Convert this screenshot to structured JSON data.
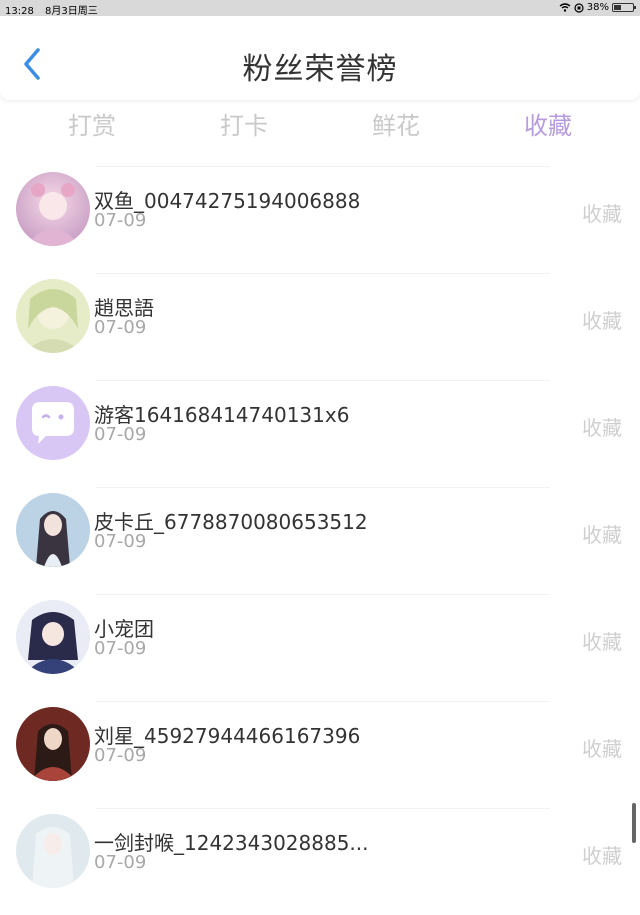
{
  "status": {
    "time": "13:28",
    "date": "8月3日周三",
    "battery": "38%",
    "battery_level": 0.38
  },
  "header": {
    "title": "粉丝荣誉榜"
  },
  "tabs": [
    {
      "label": "打赏"
    },
    {
      "label": "打卡"
    },
    {
      "label": "鲜花"
    },
    {
      "label": "收藏"
    }
  ],
  "active_tab": 3,
  "colors": {
    "accent": "#b79be0",
    "back_arrow": "#3a8ee6"
  },
  "list": [
    {
      "name": "双鱼_00474275194006888",
      "date": "07-09",
      "tag": "收藏"
    },
    {
      "name": "趙思語",
      "date": "07-09",
      "tag": "收藏"
    },
    {
      "name": "游客164168414740131x6",
      "date": "07-09",
      "tag": "收藏"
    },
    {
      "name": "皮卡丘_6778870080653512",
      "date": "07-09",
      "tag": "收藏"
    },
    {
      "name": "小宠团",
      "date": "07-09",
      "tag": "收藏"
    },
    {
      "name": "刘星_45927944466167396",
      "date": "07-09",
      "tag": "收藏"
    },
    {
      "name": "一剑封喉_1242343028885...",
      "date": "07-09",
      "tag": "收藏"
    }
  ]
}
